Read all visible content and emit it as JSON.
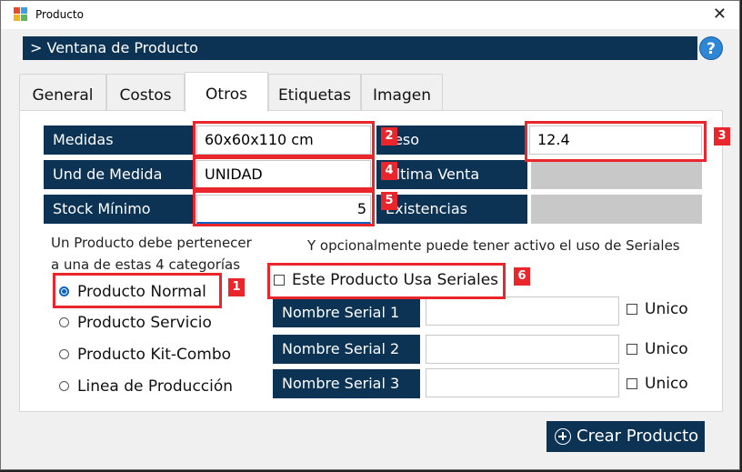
{
  "window": {
    "title": "Producto"
  },
  "header": {
    "title": "> Ventana de Producto",
    "help": "?"
  },
  "tabs": [
    {
      "label": "General"
    },
    {
      "label": "Costos"
    },
    {
      "label": "Otros"
    },
    {
      "label": "Etiquetas"
    },
    {
      "label": "Imagen"
    }
  ],
  "fields": {
    "medidas": {
      "label": "Medidas",
      "value": "60x60x110 cm"
    },
    "peso": {
      "label": "Peso",
      "value": "12.4"
    },
    "und_medida": {
      "label": "Und de Medida",
      "value": "UNIDAD"
    },
    "ultima_venta": {
      "label": "Ultima Venta",
      "value": ""
    },
    "stock_minimo": {
      "label": "Stock Mínimo",
      "value": "5"
    },
    "existencias": {
      "label": "Existencias",
      "value": ""
    }
  },
  "category": {
    "line1": "Un Producto debe pertenecer",
    "line2": "a una de estas 4 categorías",
    "options": [
      "Producto Normal",
      "Producto Servicio",
      "Producto Kit-Combo",
      "Linea de Producción"
    ],
    "selected": "Producto Normal"
  },
  "serials": {
    "note": "Y opcionalmente puede tener activo el uso de Seriales",
    "uses_label": "Este Producto Usa Seriales",
    "uses_checked": false,
    "items": [
      {
        "label": "Nombre Serial 1",
        "unico": "Unico"
      },
      {
        "label": "Nombre Serial 2",
        "unico": "Unico"
      },
      {
        "label": "Nombre Serial 3",
        "unico": "Unico"
      }
    ]
  },
  "badges": [
    "1",
    "2",
    "3",
    "4",
    "5",
    "6"
  ],
  "actions": {
    "create": "Crear Producto"
  },
  "colors": {
    "navy": "#0c3254",
    "annotation_red": "#e8262b",
    "radio_blue": "#0a62c2"
  }
}
